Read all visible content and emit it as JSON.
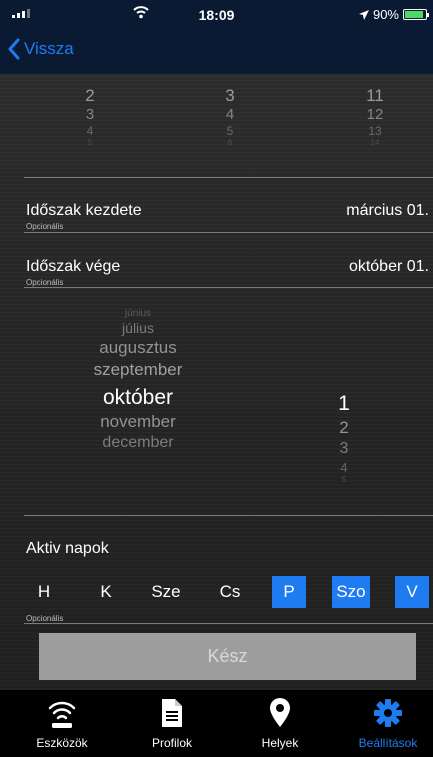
{
  "status_bar": {
    "time": "18:09",
    "battery": "90%",
    "battery_level": 0.9
  },
  "nav": {
    "back_label": "Vissza"
  },
  "top_picker": {
    "col1": [
      "2",
      "3",
      "4",
      "5"
    ],
    "col2": [
      "3",
      "4",
      "5",
      "6"
    ],
    "col3": [
      "11",
      "12",
      "13",
      "14"
    ]
  },
  "period_start": {
    "label": "Időszak kezdete",
    "hint": "Opcionális",
    "value": "március 01."
  },
  "period_end": {
    "label": "Időszak vége",
    "hint": "Opcionális",
    "value": "október 01."
  },
  "month_picker": {
    "months": [
      "június",
      "július",
      "augusztus",
      "szeptember",
      "október",
      "november",
      "december"
    ],
    "selected_month": "október",
    "days": [
      "1",
      "2",
      "3",
      "4",
      "5"
    ],
    "selected_day": "1"
  },
  "active_days": {
    "label": "Aktiv napok",
    "hint": "Opcionális",
    "days": [
      {
        "label": "H",
        "on": false
      },
      {
        "label": "K",
        "on": false
      },
      {
        "label": "Sze",
        "on": false
      },
      {
        "label": "Cs",
        "on": false
      },
      {
        "label": "P",
        "on": true
      },
      {
        "label": "Szo",
        "on": true
      },
      {
        "label": "V",
        "on": true
      }
    ]
  },
  "done_label": "Kész",
  "tabs": [
    {
      "label": "Eszközök",
      "icon": "wifi-icon",
      "active": false
    },
    {
      "label": "Profilok",
      "icon": "document-icon",
      "active": false
    },
    {
      "label": "Helyek",
      "icon": "map-pin-icon",
      "active": false
    },
    {
      "label": "Beállítások",
      "icon": "gear-icon",
      "active": true
    }
  ],
  "colors": {
    "accent": "#1f7cf0",
    "nav_bg": "#0a1a33",
    "done_bg": "#9d9d9d"
  }
}
